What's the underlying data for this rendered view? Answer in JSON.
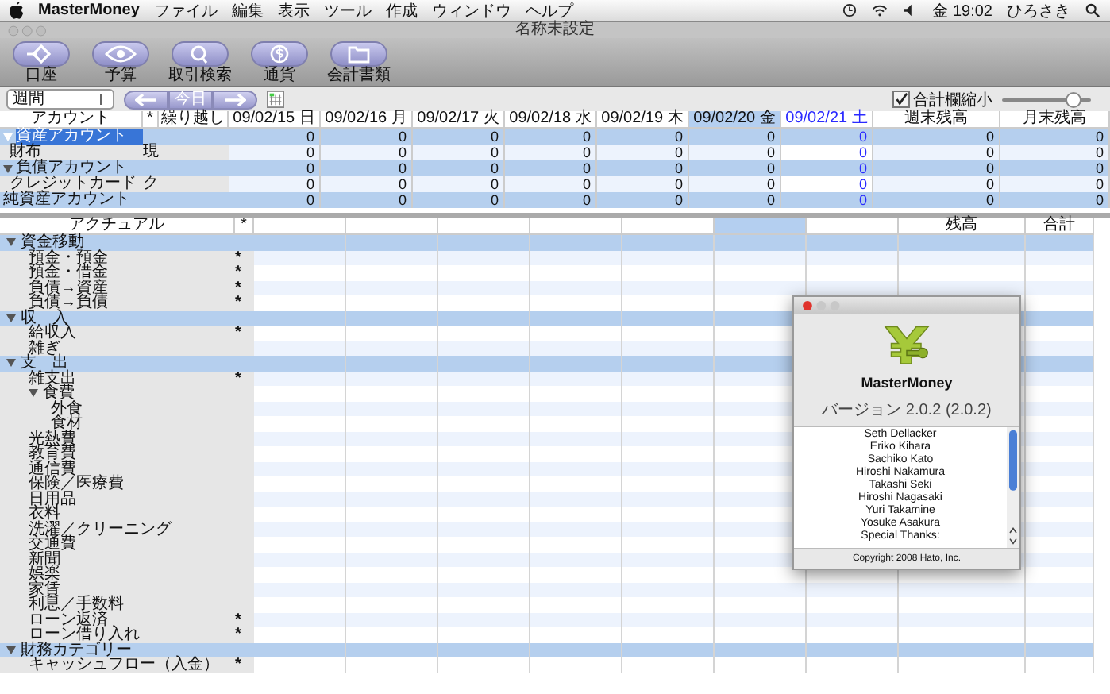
{
  "menu_bar": {
    "app": "MasterMoney",
    "menus": [
      "ファイル",
      "編集",
      "表示",
      "ツール",
      "作成",
      "ウィンドウ",
      "ヘルプ"
    ],
    "clock": "金 19:02",
    "user": "ひろさき"
  },
  "window": {
    "title": "名称未設定"
  },
  "toolbar": [
    {
      "label": "口座"
    },
    {
      "label": "予算"
    },
    {
      "label": "取引検索"
    },
    {
      "label": "通貨"
    },
    {
      "label": "会計書類"
    }
  ],
  "controls": {
    "period": "週間",
    "today_button": "今日",
    "compact_totals": {
      "label": "合計欄縮小",
      "checked": true
    },
    "zoom": {
      "level": 0.8
    }
  },
  "top_table": {
    "columns": [
      {
        "label": "アカウント"
      },
      {
        "label": "*"
      },
      {
        "label": "繰り越し"
      }
    ],
    "date_columns": [
      {
        "label": "09/02/15 日",
        "selected": false,
        "today": false
      },
      {
        "label": "09/02/16 月",
        "selected": false,
        "today": false
      },
      {
        "label": "09/02/17 火",
        "selected": false,
        "today": false
      },
      {
        "label": "09/02/18 水",
        "selected": false,
        "today": false
      },
      {
        "label": "09/02/19 木",
        "selected": false,
        "today": false
      },
      {
        "label": "09/02/20 金",
        "selected": true,
        "today": false
      },
      {
        "label": "09/02/21 土",
        "selected": false,
        "today": true
      }
    ],
    "end_columns": [
      {
        "label": "週末残高"
      },
      {
        "label": "月末残高"
      }
    ],
    "rows": [
      {
        "kind": "group",
        "name": "資産アカウント",
        "expanded": true,
        "selected": true,
        "values": [
          "0",
          "0",
          "0",
          "0",
          "0",
          "0",
          "0",
          "0",
          "0"
        ]
      },
      {
        "kind": "account",
        "name": "財布",
        "mark": "現",
        "selected": false,
        "values": [
          "0",
          "0",
          "0",
          "0",
          "0",
          "0",
          "0",
          "0",
          "0"
        ]
      },
      {
        "kind": "group",
        "name": "負債アカウント",
        "expanded": true,
        "selected": false,
        "values": [
          "0",
          "0",
          "0",
          "0",
          "0",
          "0",
          "0",
          "0",
          "0"
        ]
      },
      {
        "kind": "account",
        "name": "クレジットカード",
        "mark": "ク",
        "selected": false,
        "values": [
          "0",
          "0",
          "0",
          "0",
          "0",
          "0",
          "0",
          "0",
          "0"
        ]
      },
      {
        "kind": "summary",
        "name": "純資産アカウント",
        "selected": false,
        "values": [
          "0",
          "0",
          "0",
          "0",
          "0",
          "0",
          "0",
          "0",
          "0"
        ]
      }
    ]
  },
  "categories": {
    "header": {
      "name": "アクチュアル",
      "mark": "*",
      "column_10": "残高",
      "column_11": "合計"
    },
    "groups": [
      {
        "name": "資金移動",
        "expanded": true,
        "children": [
          {
            "name": "預金・預金",
            "mark": "*"
          },
          {
            "name": "預金・借金",
            "mark": "*"
          },
          {
            "name": "負債→資産",
            "mark": "*"
          },
          {
            "name": "負債→負債",
            "mark": "*"
          }
        ]
      },
      {
        "name": "収　入",
        "expanded": true,
        "children": [
          {
            "name": "給収入",
            "mark": "*"
          },
          {
            "name": "雑ぎ"
          }
        ]
      },
      {
        "name": "支　出",
        "expanded": true,
        "children": [
          {
            "name": "雑支出",
            "mark": "*"
          },
          {
            "name": "食費",
            "expanded": true,
            "children": [
              {
                "name": "外食"
              },
              {
                "name": "食材"
              }
            ]
          },
          {
            "name": "光熱費"
          },
          {
            "name": "教育費"
          },
          {
            "name": "通信費"
          },
          {
            "name": "保険／医療費"
          },
          {
            "name": "日用品"
          },
          {
            "name": "衣料"
          },
          {
            "name": "洗濯／クリーニング"
          },
          {
            "name": "交通費"
          },
          {
            "name": "新聞"
          },
          {
            "name": "娯楽"
          },
          {
            "name": "家賃"
          },
          {
            "name": "利息／手数料"
          },
          {
            "name": "ローン返済",
            "mark": "*"
          },
          {
            "name": "ローン借り入れ",
            "mark": "*"
          }
        ]
      },
      {
        "name": "財務カテゴリー",
        "expanded": true,
        "children": [
          {
            "name": "キャッシュフロー（入金）",
            "mark": "*"
          }
        ]
      }
    ]
  },
  "about": {
    "app": "MasterMoney",
    "version": "バージョン 2.0.2 (2.0.2)",
    "credits": [
      "Seth Dellacker",
      "Eriko Kihara",
      "Sachiko Kato",
      "Hiroshi Nakamura",
      "Takashi Seki",
      "Hiroshi Nagasaki",
      "Yuri Takamine",
      "Yosuke Asakura",
      "Special Thanks:"
    ],
    "copyright": "Copyright 2008 Hato, Inc."
  }
}
